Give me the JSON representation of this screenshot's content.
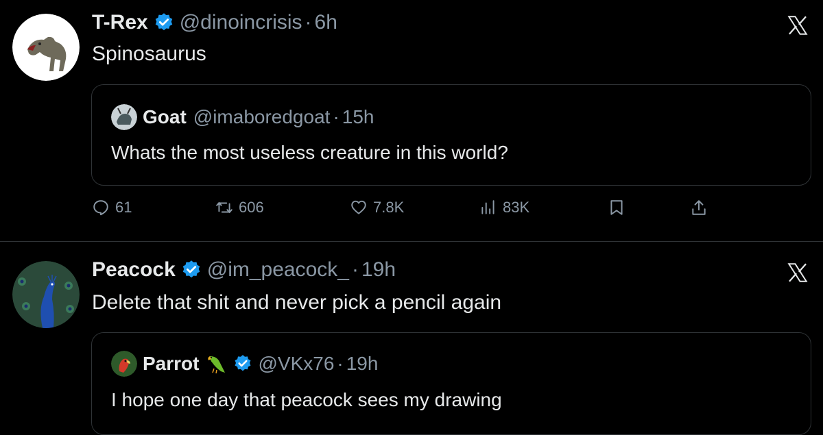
{
  "tweets": [
    {
      "name": "T-Rex",
      "handle": "@dinoincrisis",
      "dot": "·",
      "time": "6h",
      "text": "Spinosaurus",
      "avatar_icon": "trex-avatar",
      "quote": {
        "name": "Goat",
        "handle": "@imaboredgoat",
        "dot": "·",
        "time": "15h",
        "text": "Whats the most useless creature in this world?",
        "avatar_icon": "goat-avatar"
      },
      "stats": {
        "replies": "61",
        "retweets": "606",
        "likes": "7.8K",
        "views": "83K"
      }
    },
    {
      "name": "Peacock",
      "handle": "@im_peacock_",
      "dot": "·",
      "time": "19h",
      "text": "Delete that shit and never pick a pencil again",
      "avatar_icon": "peacock-avatar",
      "quote": {
        "name": "Parrot",
        "handle": "@VKx76",
        "dot": "·",
        "time": "19h",
        "text": "I hope one day that peacock sees my drawing",
        "avatar_icon": "parrot-avatar",
        "emoji_icon": "parrot-emoji"
      }
    }
  ],
  "colors": {
    "background": "#000000",
    "text": "#e7e9ea",
    "muted": "#8b98a5",
    "verified": "#1d9bf0",
    "border": "#2f3336"
  }
}
